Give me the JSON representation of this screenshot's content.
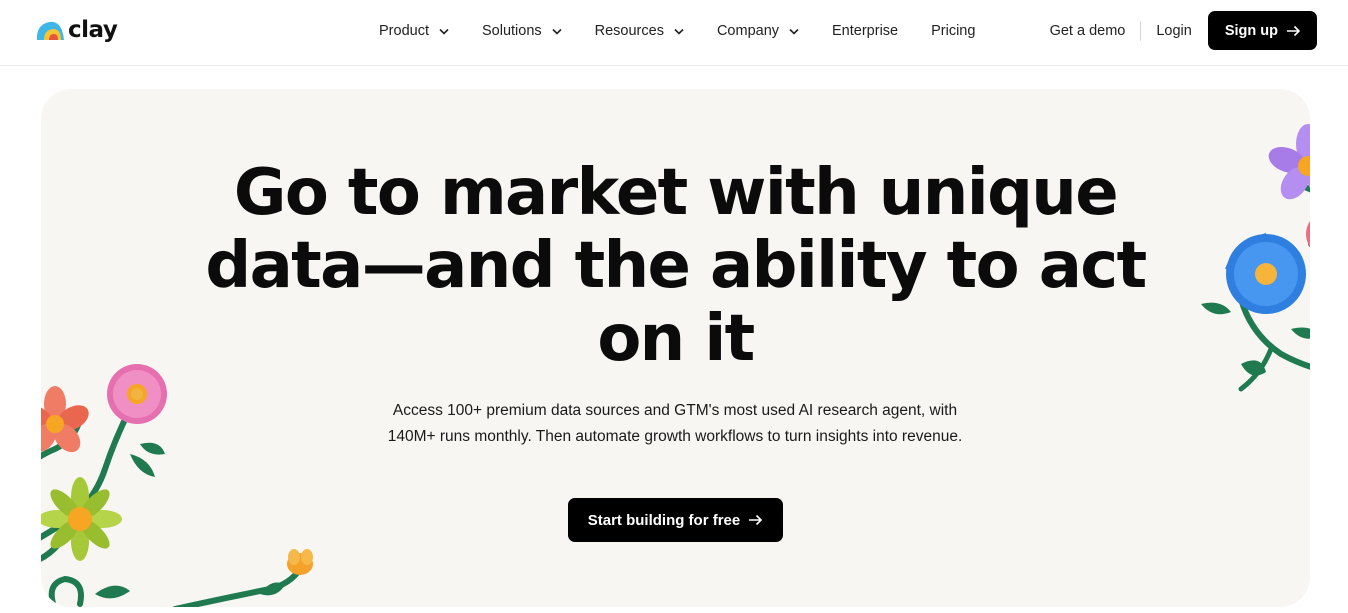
{
  "brand": {
    "name": "clay"
  },
  "nav": {
    "items": [
      {
        "label": "Product",
        "has_dropdown": true
      },
      {
        "label": "Solutions",
        "has_dropdown": true
      },
      {
        "label": "Resources",
        "has_dropdown": true
      },
      {
        "label": "Company",
        "has_dropdown": true
      },
      {
        "label": "Enterprise",
        "has_dropdown": false
      },
      {
        "label": "Pricing",
        "has_dropdown": false
      }
    ]
  },
  "header_actions": {
    "demo_label": "Get a demo",
    "login_label": "Login",
    "signup_label": "Sign up",
    "signup_icon": "arrow-right-icon"
  },
  "hero": {
    "headline_lines": [
      "Go to market with unique",
      "data—and the ability to act",
      "on it"
    ],
    "subtext": "Access 100+ premium data sources and GTM's most used AI research agent, with 140M+ runs monthly. Then automate growth workflows to turn insights into revenue.",
    "cta_label": "Start building for free",
    "cta_icon": "arrow-right-icon"
  },
  "colors": {
    "hero_background": "#f7f6f3",
    "button_background": "#000000",
    "button_text": "#ffffff",
    "stem_green": "#1f7a4f"
  }
}
